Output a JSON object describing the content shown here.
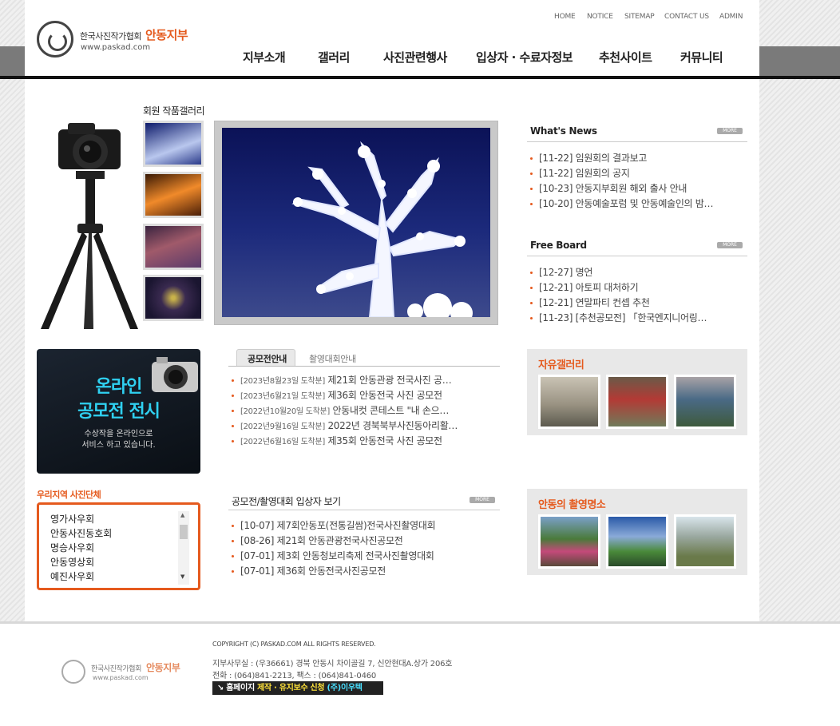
{
  "header": {
    "org_name": "한국사진작가협회",
    "branch_name": "안동지부",
    "url": "www.paskad.com",
    "util_links": [
      "HOME",
      "NOTICE",
      "SITEMAP",
      "CONTACT US",
      "ADMIN"
    ],
    "nav": [
      "지부소개",
      "갤러리",
      "사진관련행사",
      "입상자 · 수료자정보",
      "추천사이트",
      "커뮤니티"
    ]
  },
  "gallery": {
    "title": "회원 작품갤러리"
  },
  "news": {
    "title": "What's News",
    "more": "MORE",
    "items": [
      "[11-22]  임원회의 결과보고",
      "[11-22]  임원회의 공지",
      "[10-23]  안동지부회원 해외 출사 안내",
      "[10-20]  안동예술포럼 및 안동예술인의 밤…"
    ]
  },
  "board": {
    "title": "Free Board",
    "more": "MORE",
    "items": [
      "[12-27]  명언",
      "[12-21]  아토피 대처하기",
      "[12-21]  연말파티 컨셉 추천",
      "[11-23]  [추천공모전]  「한국엔지니어링…"
    ]
  },
  "online": {
    "line1": "온라인",
    "line2": "공모전 전시",
    "sub1": "수상작을 온라인으로",
    "sub2": "서비스 하고 있습니다."
  },
  "contest": {
    "tab_active": "공모전안내",
    "tab_inactive": "촬영대회안내",
    "items": [
      {
        "tag": "[2023년8월23일 도착분]",
        "text": "제21회 안동관광 전국사진 공…"
      },
      {
        "tag": "[2023년6월21일 도착분]",
        "text": "제36회 안동전국 사진 공모전"
      },
      {
        "tag": "[2022년10월20일 도착분]",
        "text": "안동내컷 콘테스트 \"내 손으…"
      },
      {
        "tag": "[2022년9월16일 도착분]",
        "text": "2022년 경북북부사진동아리활…"
      },
      {
        "tag": "[2022년6월16일 도착분]",
        "text": "제35회 안동전국 사진 공모전"
      }
    ]
  },
  "winners": {
    "title": "공모전/촬영대회 입상자 보기",
    "more": "MORE",
    "items": [
      "[10-07]  제7회안동포(전통길쌈)전국사진촬영대회",
      "[08-26]  제21회 안동관광전국사진공모전",
      "[07-01]  제3회 안동청보리축제 전국사진촬영대회",
      "[07-01]  제36회 안동전국사진공모전"
    ]
  },
  "region": {
    "title": "우리지역 사진단체",
    "items": [
      "영가사우회",
      "안동사진동호회",
      "명승사우회",
      "안동영상회",
      "예진사우회"
    ]
  },
  "free_gallery": {
    "title": "자유갤러리"
  },
  "spots": {
    "title": "안동의 촬영명소"
  },
  "footer": {
    "copyright": "COPYRIGHT (C) PASKAD.COM ALL RIGHTS RESERVED.",
    "address": "지부사무실 : (우36661) 경북 안동시 차이골길 7, 신안현대A.상가 206호",
    "phone": "전화 : (064)841-2213, 팩스 : (064)841-0460",
    "badge_a": "홈페이지",
    "badge_b": "제작 · 유지보수 신청",
    "badge_c": "(주)이우텍",
    "logo_org": "한국사진작가협회",
    "logo_branch": "안동지부",
    "logo_url": "www.paskad.com"
  }
}
